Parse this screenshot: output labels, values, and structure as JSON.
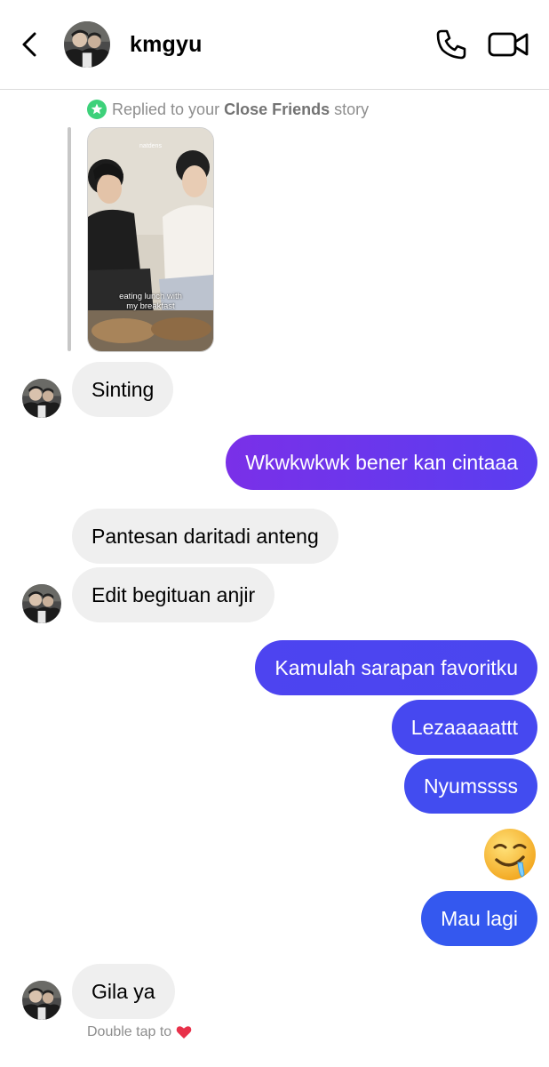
{
  "header": {
    "username": "kmgyu",
    "icons": {
      "back": "chevron-left-icon",
      "call": "phone-icon",
      "video": "video-camera-icon"
    }
  },
  "reply": {
    "prefix": "Replied to your",
    "highlight": "Close Friends",
    "suffix": "story",
    "story_top_text": "natdens",
    "story_caption_line1": "eating lunch with",
    "story_caption_line2": "my breakfast"
  },
  "messages": [
    {
      "from": "them",
      "text": "Sinting"
    },
    {
      "from": "me",
      "text": "Wkwkwkwk bener kan cintaaa"
    },
    {
      "from": "them",
      "text": "Pantesan daritadi anteng"
    },
    {
      "from": "them",
      "text": "Edit begituan anjir"
    },
    {
      "from": "me",
      "text": "Kamulah sarapan favoritku"
    },
    {
      "from": "me",
      "text": "Lezaaaaattt"
    },
    {
      "from": "me",
      "text": "Nyumssss"
    },
    {
      "from": "me",
      "emoji": "drooling-face"
    },
    {
      "from": "me",
      "text": "Mau lagi"
    },
    {
      "from": "them",
      "text": "Gila ya"
    }
  ],
  "footer": {
    "hint": "Double tap to",
    "hint_icon": "heart-icon"
  },
  "colors": {
    "incoming_bubble": "#efefef",
    "outgoing_gradient": [
      "#8a2be2",
      "#5b3cf0",
      "#3f4ff0",
      "#2f60f0"
    ],
    "close_friends_green": "#3dd17a",
    "heart": "#e8314a"
  }
}
